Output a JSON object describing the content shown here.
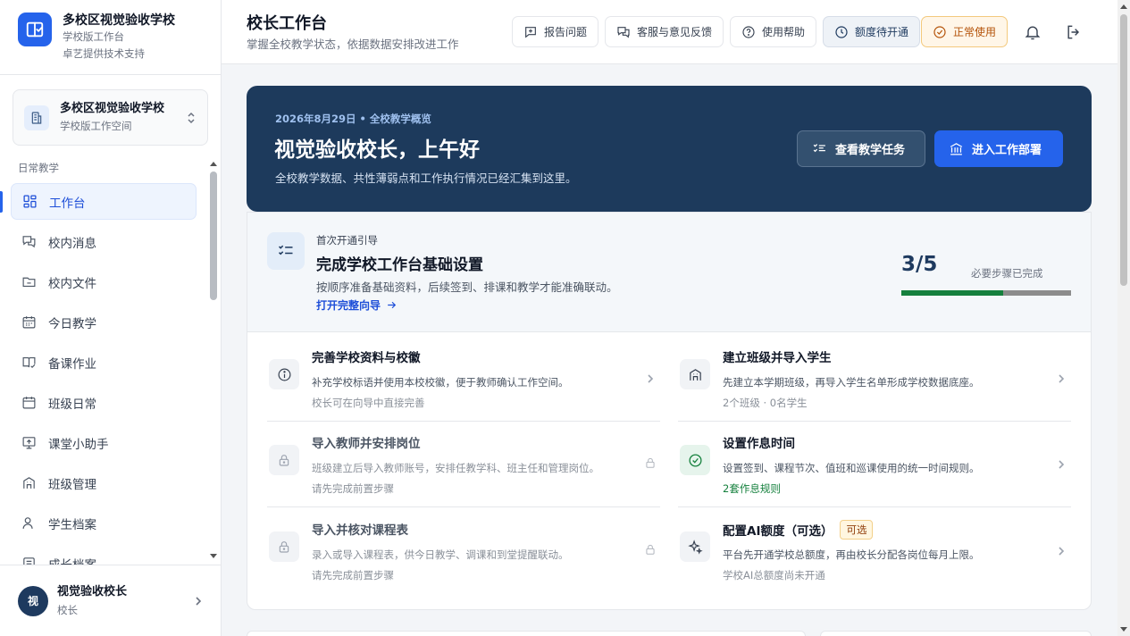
{
  "brand": {
    "title": "多校区视觉验收学校",
    "line1": "学校版工作台",
    "line2": "卓艺提供技术支持"
  },
  "school_switcher": {
    "name": "多校区视觉验收学校",
    "sub": "学校版工作空间"
  },
  "sidebar": {
    "section": "日常教学",
    "items": [
      {
        "label": "工作台",
        "icon": "dashboard-icon",
        "active": true
      },
      {
        "label": "校内消息",
        "icon": "messages-icon"
      },
      {
        "label": "校内文件",
        "icon": "folder-icon"
      },
      {
        "label": "今日教学",
        "icon": "calendar-icon"
      },
      {
        "label": "备课作业",
        "icon": "book-icon"
      },
      {
        "label": "班级日常",
        "icon": "calendar-check-icon"
      },
      {
        "label": "课堂小助手",
        "icon": "screen-icon"
      },
      {
        "label": "班级管理",
        "icon": "building-icon"
      },
      {
        "label": "学生档案",
        "icon": "user-icon"
      },
      {
        "label": "成长档案",
        "icon": "archive-icon"
      }
    ]
  },
  "user": {
    "avatar": "视",
    "name": "视觉验收校长",
    "role": "校长"
  },
  "header": {
    "title": "校长工作台",
    "subtitle": "掌握全校教学状态，依据数据安排改进工作",
    "buttons": {
      "report": "报告问题",
      "feedback": "客服与意见反馈",
      "help": "使用帮助",
      "quota": "额度待开通",
      "status": "正常使用"
    }
  },
  "hero": {
    "date": "2026年8月29日 • 全校教学概览",
    "greeting": "视觉验收校长，上午好",
    "desc": "全校教学数据、共性薄弱点和工作执行情况已经汇集到这里。",
    "btn_tasks": "查看教学任务",
    "btn_deploy": "进入工作部署"
  },
  "setup": {
    "kicker": "首次开通引导",
    "title": "完成学校工作台基础设置",
    "desc": "按顺序准备基础资料，后续签到、排课和教学才能准确联动。",
    "link": "打开完整向导",
    "progress_text": "3/5",
    "progress_label": "必要步骤已完成",
    "progress_fraction": 0.6,
    "tasks": [
      {
        "title": "完善学校资料与校徽",
        "desc": "补充学校标语并使用本校校徽，便于教师确认工作空间。",
        "meta": "校长可在向导中直接完善",
        "icon": "info-icon",
        "state": "open"
      },
      {
        "title": "建立班级并导入学生",
        "desc": "先建立本学期班级，再导入学生名单形成学校数据底座。",
        "meta": "2个班级 · 0名学生",
        "icon": "building-icon",
        "state": "open"
      },
      {
        "title": "导入教师并安排岗位",
        "desc": "班级建立后导入教师账号，安排任教学科、班主任和管理岗位。",
        "meta": "请先完成前置步骤",
        "icon": "lock-icon",
        "state": "locked"
      },
      {
        "title": "设置作息时间",
        "desc": "设置签到、课程节次、值班和巡课使用的统一时间规则。",
        "meta": "2套作息规则",
        "icon": "check-circle-icon",
        "state": "done"
      },
      {
        "title": "导入并核对课程表",
        "desc": "录入或导入课程表，供今日教学、调课和到堂提醒联动。",
        "meta": "请先完成前置步骤",
        "icon": "lock-icon",
        "state": "locked"
      },
      {
        "title": "配置AI额度（可选）",
        "tag": "可选",
        "desc": "平台先开通学校总额度，再由校长分配各岗位每月上限。",
        "meta": "学校AI总额度尚未开通",
        "icon": "sparkle-icon",
        "state": "open"
      }
    ]
  },
  "colors": {
    "accent": "#2563eb",
    "hero_bg": "#1d3a5c",
    "success": "#15803d",
    "warning": "#b45309"
  }
}
